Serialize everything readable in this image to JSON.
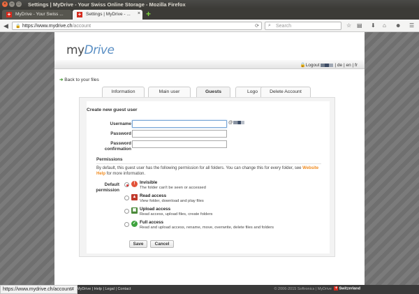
{
  "window": {
    "title": "Settings | MyDrive - Your Swiss Online Storage - Mozilla Firefox"
  },
  "browser": {
    "tabs": [
      {
        "label": "MyDrive - Your Swiss ..."
      },
      {
        "label": "Settings | MyDrive - ..."
      }
    ],
    "url_host": "https://www.mydrive.ch",
    "url_path": "/account",
    "search_placeholder": "Search",
    "status_url": "https://www.mydrive.ch/account#"
  },
  "site": {
    "logo_my": "my",
    "logo_drive": "Drive",
    "logout": "Logout",
    "languages": [
      "de",
      "en",
      "fr"
    ],
    "back_link": "Back to your files",
    "tabs": [
      "Information",
      "Main user",
      "Guests",
      "Logo",
      "Delete Account"
    ]
  },
  "form": {
    "title": "Create new guest user",
    "username_label": "Username",
    "password_label": "Password",
    "password_confirm_label_1": "Password",
    "password_confirm_label_2": "confirmation",
    "at_symbol": "@",
    "permissions_title": "Permissions",
    "permissions_desc": "By default, this guest user has the following permission for all folders. You can change this for every folder, see",
    "permissions_link": "Website Help",
    "permissions_desc_tail": "for more information.",
    "default_permission_label_1": "Default",
    "default_permission_label_2": "permission",
    "options": [
      {
        "title": "Invisible",
        "desc": "The folder can't be seen or accessed",
        "checked": true,
        "icon": "invisible-icon",
        "color": "#e2533a"
      },
      {
        "title": "Read access",
        "desc": "View folder, download and play files",
        "checked": false,
        "icon": "read-icon",
        "color": "#c0392b"
      },
      {
        "title": "Upload access",
        "desc": "Read access, upload files, create folders",
        "checked": false,
        "icon": "upload-icon",
        "color": "#4b8a3a"
      },
      {
        "title": "Full access",
        "desc": "Read and upload access, rename, move, overwrite, delete files and folders",
        "checked": false,
        "icon": "full-access-icon",
        "color": "#3ea33e"
      }
    ],
    "save_label": "Save",
    "cancel_label": "Cancel"
  },
  "footer": {
    "links": [
      "MyDrive",
      "Help",
      "Legal",
      "Contact"
    ],
    "copyright": "© 2006-2015 Softronics | MyDrive",
    "swiss": "Switzerland"
  },
  "colors": {
    "accent": "#5a8fc4",
    "highlight": "#f08a1d",
    "swiss_red": "#d52b1e"
  }
}
